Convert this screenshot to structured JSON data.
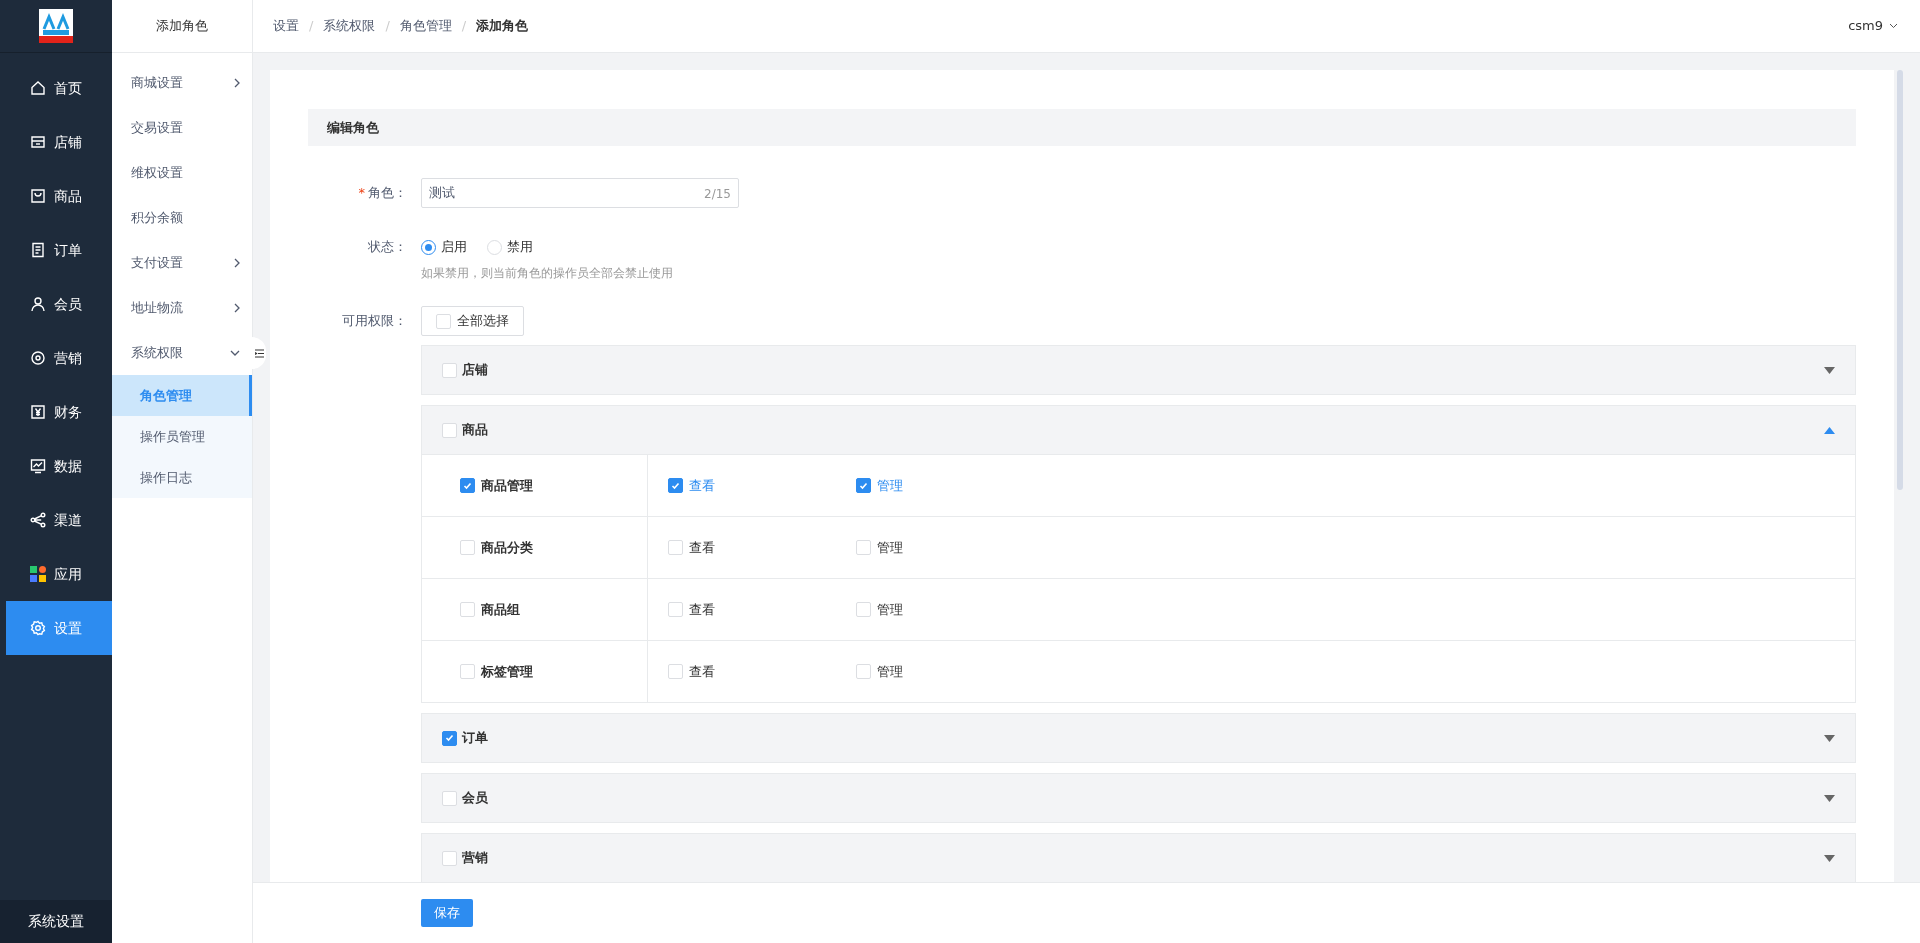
{
  "nav": {
    "items": [
      {
        "label": "首页",
        "selected": false
      },
      {
        "label": "店铺",
        "selected": false
      },
      {
        "label": "商品",
        "selected": false
      },
      {
        "label": "订单",
        "selected": false
      },
      {
        "label": "会员",
        "selected": false
      },
      {
        "label": "营销",
        "selected": false
      },
      {
        "label": "财务",
        "selected": false
      },
      {
        "label": "数据",
        "selected": false
      },
      {
        "label": "渠道",
        "selected": false
      },
      {
        "label": "应用",
        "selected": false
      },
      {
        "label": "设置",
        "selected": true
      }
    ],
    "footer": "系统设置"
  },
  "subnav": {
    "title": "添加角色",
    "items": [
      {
        "label": "商城设置",
        "kind": "group",
        "expanded": false
      },
      {
        "label": "交易设置",
        "kind": "link"
      },
      {
        "label": "维权设置",
        "kind": "link"
      },
      {
        "label": "积分余额",
        "kind": "link"
      },
      {
        "label": "支付设置",
        "kind": "group",
        "expanded": false
      },
      {
        "label": "地址物流",
        "kind": "group",
        "expanded": false
      },
      {
        "label": "系统权限",
        "kind": "group",
        "expanded": true,
        "children": [
          {
            "label": "角色管理",
            "selected": true
          },
          {
            "label": "操作员管理",
            "selected": false
          },
          {
            "label": "操作日志",
            "selected": false
          }
        ]
      }
    ]
  },
  "breadcrumb": [
    "设置",
    "系统权限",
    "角色管理",
    "添加角色"
  ],
  "breadcrumb_separator": "/",
  "user": "csm9",
  "form": {
    "section_title": "编辑角色",
    "role": {
      "label": "角色：",
      "required_mark": "*",
      "value": "测试",
      "counter": "2/15"
    },
    "status": {
      "label": "状态：",
      "options": [
        {
          "label": "启用",
          "selected": true
        },
        {
          "label": "禁用",
          "selected": false
        }
      ],
      "hint": "如果禁用，则当前角色的操作员全部会禁止使用"
    },
    "permissions": {
      "label": "可用权限：",
      "select_all": {
        "label": "全部选择",
        "checked": false
      },
      "groups": [
        {
          "label": "店铺",
          "checked": false,
          "expanded": false
        },
        {
          "label": "商品",
          "checked": false,
          "expanded": true,
          "rows": [
            {
              "label": "商品管理",
              "checked": true,
              "actions": [
                {
                  "label": "查看",
                  "checked": true
                },
                {
                  "label": "管理",
                  "checked": true
                }
              ]
            },
            {
              "label": "商品分类",
              "checked": false,
              "actions": [
                {
                  "label": "查看",
                  "checked": false
                },
                {
                  "label": "管理",
                  "checked": false
                }
              ]
            },
            {
              "label": "商品组",
              "checked": false,
              "actions": [
                {
                  "label": "查看",
                  "checked": false
                },
                {
                  "label": "管理",
                  "checked": false
                }
              ]
            },
            {
              "label": "标签管理",
              "checked": false,
              "actions": [
                {
                  "label": "查看",
                  "checked": false
                },
                {
                  "label": "管理",
                  "checked": false
                }
              ]
            }
          ]
        },
        {
          "label": "订单",
          "checked": true,
          "expanded": false
        },
        {
          "label": "会员",
          "checked": false,
          "expanded": false
        },
        {
          "label": "营销",
          "checked": false,
          "expanded": false
        }
      ]
    }
  },
  "save_button": "保存"
}
